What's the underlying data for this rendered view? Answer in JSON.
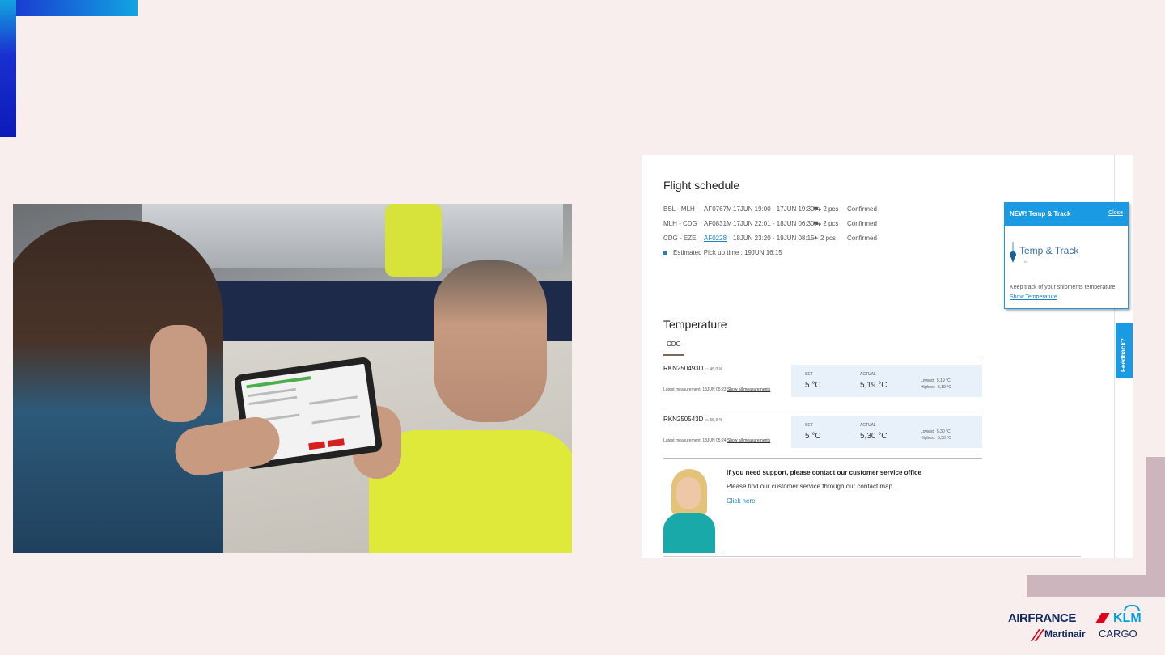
{
  "flight_schedule": {
    "title": "Flight schedule",
    "rows": [
      {
        "route": "BSL - MLH",
        "flight": "AF0767M",
        "time": "17JUN 19:00 - 17JUN 19:30",
        "pcs": "2 pcs",
        "status": "Confirmed",
        "mode": "truck"
      },
      {
        "route": "MLH - CDG",
        "flight": "AF0831M",
        "time": "17JUN 22:01 - 18JUN 06:30",
        "pcs": "2 pcs",
        "status": "Confirmed",
        "mode": "truck"
      },
      {
        "route": "CDG - EZE",
        "flight": "AF0228",
        "time": "18JUN 23:20 - 19JUN 08:15",
        "pcs": "2 pcs",
        "status": "Confirmed",
        "mode": "plane"
      }
    ],
    "pickup": "Estimated Pick up time : 19JUN 16:15"
  },
  "temperature": {
    "title": "Temperature",
    "tab": "CDG",
    "set_label": "SET",
    "actual_label": "ACTUAL",
    "lowest_label": "Lowest",
    "highest_label": "Highest",
    "show_all": "Show all measurements",
    "items": [
      {
        "id": "RKN250493D",
        "battery": "45,0 %",
        "latest": "Latest measurement: 18JUN 05:23",
        "set": "5 °C",
        "actual": "5,19 °C",
        "lowest": "5,19 °C",
        "highest": "5,19 °C"
      },
      {
        "id": "RKN250543D",
        "battery": "55,0 %",
        "latest": "Latest measurement: 18JUN 05:24",
        "set": "5 °C",
        "actual": "5,30 °C",
        "lowest": "5,30 °C",
        "highest": "5,30 °C"
      }
    ]
  },
  "support": {
    "title": "If you need support, please contact our customer service office",
    "desc": "Please find our customer service through our contact map.",
    "link": "Click here"
  },
  "popup": {
    "title": "NEW! Temp & Track",
    "close": "Close",
    "logo_text": "Temp & Track",
    "logo_by": "by",
    "text": "Keep track of your shipments temperature.",
    "link": "Show Temperature"
  },
  "feedback": "Feedback?",
  "brand": {
    "airfrance": "AIRFRANCE",
    "klm": "KLM",
    "martinair": "Martinair",
    "cargo": "CARGO"
  },
  "colors": {
    "accent": "#1a9ae3",
    "background": "#f8eeee",
    "deco_blue": "#1a2fd0",
    "deco_mauve": "#cdb5be"
  }
}
